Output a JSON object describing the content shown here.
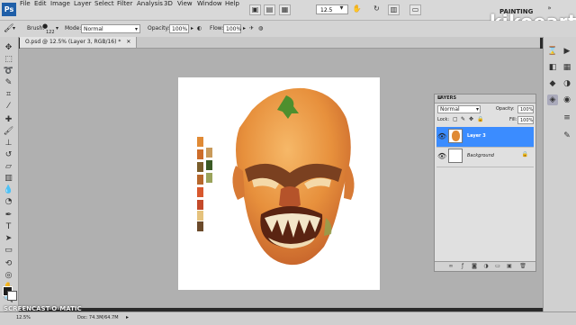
{
  "menubar": {
    "app_logo": "Ps",
    "items": [
      "File",
      "Edit",
      "Image",
      "Layer",
      "Select",
      "Filter",
      "Analysis",
      "3D",
      "View",
      "Window",
      "Help"
    ],
    "zoom_value": "12.5",
    "workspace_label": "PAINTING"
  },
  "brand_watermark": "kikoeart",
  "options_bar": {
    "brush_label": "Brush:",
    "brush_size": "122",
    "mode_label": "Mode:",
    "mode_value": "Normal",
    "opacity_label": "Opacity:",
    "opacity_value": "100%",
    "flow_label": "Flow:",
    "flow_value": "100%"
  },
  "document_tab": {
    "title": "O.psd @ 12.5% (Layer 3, RGB/16) *"
  },
  "status_bar": {
    "zoom": "12.5%",
    "doc_info": "Doc: 74.3M/64.7M"
  },
  "recorder_watermark": "SCREENCAST-O-MATIC",
  "layers_panel": {
    "title": "LAYERS",
    "blend_mode": "Normal",
    "opacity_label": "Opacity:",
    "opacity_value": "100%",
    "lock_label": "Lock:",
    "fill_label": "Fill:",
    "fill_value": "100%",
    "layers": [
      {
        "name": "Layer 3",
        "selected": true
      },
      {
        "name": "Background",
        "selected": false
      }
    ]
  },
  "colors": {
    "accent_selection": "#3b8cff",
    "canvas_gray": "#b0b0b0",
    "palette_swatches": [
      "#e08a35",
      "#cd6d2a",
      "#c99a5a",
      "#7a5d2a",
      "#b7672c",
      "#3b5a25",
      "#d8582e",
      "#9aa35b",
      "#c44a2a",
      "#e5c27c",
      "#6b4a2a"
    ]
  },
  "icons": {
    "toolbox": [
      "move-icon",
      "marquee-icon",
      "lasso-icon",
      "quick-select-icon",
      "crop-icon",
      "eyedropper-icon",
      "healing-icon",
      "brush-icon",
      "clone-stamp-icon",
      "history-brush-icon",
      "eraser-icon",
      "gradient-icon",
      "blur-icon",
      "dodge-icon",
      "pen-icon",
      "type-icon",
      "path-select-icon",
      "shape-icon",
      "3d-rotate-icon",
      "3d-orbit-icon",
      "hand-icon",
      "zoom-icon"
    ],
    "right_dock": [
      "history-icon",
      "actions-icon",
      "color-icon",
      "swatches-icon",
      "styles-icon",
      "adjustments-icon",
      "masks-icon",
      "layers-icon",
      "channels-icon",
      "paths-icon"
    ]
  }
}
